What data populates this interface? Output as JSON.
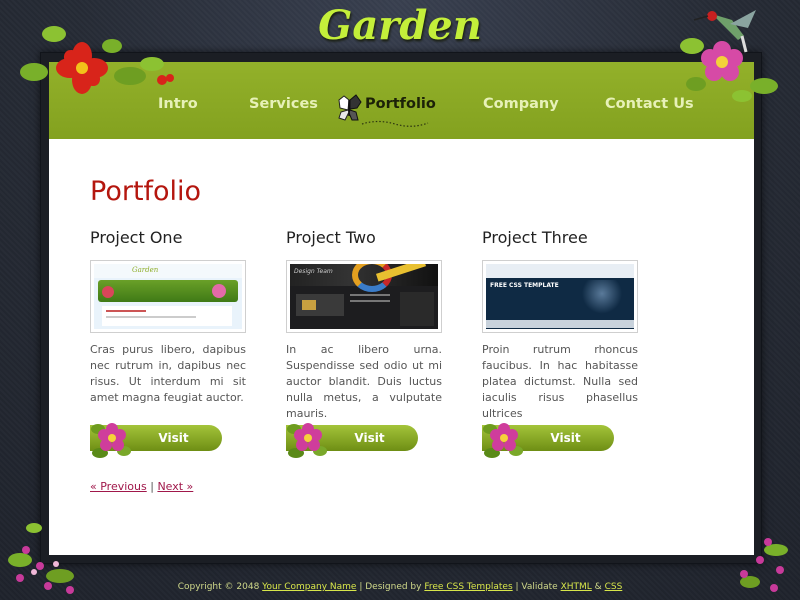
{
  "site": {
    "title": "Garden"
  },
  "nav": {
    "items": [
      {
        "label": "Intro"
      },
      {
        "label": "Services"
      },
      {
        "label": "Portfolio"
      },
      {
        "label": "Company"
      },
      {
        "label": "Contact Us"
      }
    ],
    "active": "Portfolio"
  },
  "main": {
    "title": "Portfolio",
    "projects": [
      {
        "title": "Project One",
        "description": "Cras purus libero, dapibus nec rutrum in, dapibus nec risus. Ut interdum mi sit amet magna feugiat auctor.",
        "button": "Visit",
        "thumb_text": "Garden"
      },
      {
        "title": "Project Two",
        "description": "In ac libero urna. Suspendisse sed odio ut mi auctor blandit. Duis luctus nulla metus, a vulputate mauris.",
        "button": "Visit",
        "thumb_text": "Design Team"
      },
      {
        "title": "Project Three",
        "description": "Proin rutrum rhoncus faucibus. In hac habitasse platea dictumst. Nulla sed iaculis risus phasellus ultrices",
        "button": "Visit",
        "thumb_text": "FREE CSS TEMPLATE"
      }
    ],
    "pager": {
      "previous": "« Previous",
      "separator": "|",
      "next": "Next »"
    }
  },
  "footer": {
    "copyright": "Copyright © 2048",
    "company_link": "Your Company Name",
    "designed_by_prefix": "| Designed by",
    "designer_link": "Free CSS Templates",
    "validate_prefix": "| Validate",
    "xhtml_link": "XHTML",
    "amp": "&",
    "css_link": "CSS"
  },
  "colors": {
    "brand_green": "#8aa823",
    "title_green": "#c4ef3a",
    "heading_red": "#b4160e",
    "link_color": "#a0174a"
  },
  "icons": [
    "butterfly-icon",
    "flower-decoration",
    "hummingbird-icon",
    "visit-flower-icon"
  ]
}
